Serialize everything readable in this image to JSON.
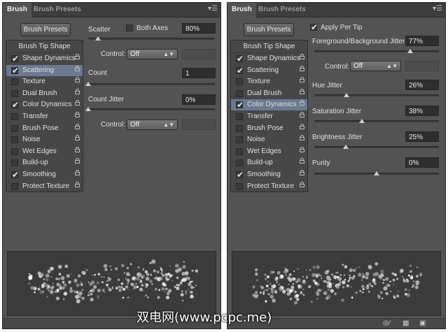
{
  "left": {
    "tabs": [
      "Brush",
      "Brush Presets"
    ],
    "presets_button": "Brush Presets",
    "list_header": "Brush Tip Shape",
    "items": [
      {
        "label": "Shape Dynamics",
        "checked": true,
        "selected": false
      },
      {
        "label": "Scattering",
        "checked": true,
        "selected": true
      },
      {
        "label": "Texture",
        "checked": false,
        "selected": false
      },
      {
        "label": "Dual Brush",
        "checked": false,
        "selected": false
      },
      {
        "label": "Color Dynamics",
        "checked": true,
        "selected": false
      },
      {
        "label": "Transfer",
        "checked": false,
        "selected": false
      },
      {
        "label": "Brush Pose",
        "checked": false,
        "selected": false
      },
      {
        "label": "Noise",
        "checked": false,
        "selected": false
      },
      {
        "label": "Wet Edges",
        "checked": false,
        "selected": false
      },
      {
        "label": "Build-up",
        "checked": false,
        "selected": false
      },
      {
        "label": "Smoothing",
        "checked": true,
        "selected": false
      },
      {
        "label": "Protect Texture",
        "checked": false,
        "selected": false
      }
    ],
    "scatter": {
      "label": "Scatter",
      "both_axes_label": "Both Axes",
      "both_axes_checked": false,
      "value": "80%",
      "level": 0.08
    },
    "control1": {
      "label": "Control:",
      "value": "Off"
    },
    "count": {
      "label": "Count",
      "value": "1",
      "level": 0.0
    },
    "count_jitter": {
      "label": "Count Jitter",
      "value": "0%",
      "level": 0.0
    },
    "control2": {
      "label": "Control:",
      "value": "Off"
    }
  },
  "right": {
    "tabs": [
      "Brush",
      "Brush Presets"
    ],
    "presets_button": "Brush Presets",
    "list_header": "Brush Tip Shape",
    "items": [
      {
        "label": "Shape Dynamics",
        "checked": true,
        "selected": false
      },
      {
        "label": "Scattering",
        "checked": true,
        "selected": false
      },
      {
        "label": "Texture",
        "checked": false,
        "selected": false
      },
      {
        "label": "Dual Brush",
        "checked": false,
        "selected": false
      },
      {
        "label": "Color Dynamics",
        "checked": true,
        "selected": true
      },
      {
        "label": "Transfer",
        "checked": false,
        "selected": false
      },
      {
        "label": "Brush Pose",
        "checked": false,
        "selected": false
      },
      {
        "label": "Noise",
        "checked": false,
        "selected": false
      },
      {
        "label": "Wet Edges",
        "checked": false,
        "selected": false
      },
      {
        "label": "Build-up",
        "checked": false,
        "selected": false
      },
      {
        "label": "Smoothing",
        "checked": true,
        "selected": false
      },
      {
        "label": "Protect Texture",
        "checked": false,
        "selected": false
      }
    ],
    "apply_per_tip": {
      "label": "Apply Per Tip",
      "checked": true
    },
    "fg_bg_jitter": {
      "label": "Foreground/Background Jitter",
      "value": "77%",
      "level": 0.77
    },
    "control": {
      "label": "Control:",
      "value": "Off"
    },
    "hue_jitter": {
      "label": "Hue Jitter",
      "value": "26%",
      "level": 0.26
    },
    "saturation_jitter": {
      "label": "Saturation Jitter",
      "value": "38%",
      "level": 0.38
    },
    "brightness_jitter": {
      "label": "Brightness Jitter",
      "value": "25%",
      "level": 0.25
    },
    "purity": {
      "label": "Purity",
      "value": "0%",
      "level": 0.5
    }
  },
  "icons": [
    "panel-menu-icon",
    "lock-icon",
    "toggle-preview-icon",
    "grid-icon",
    "new-preset-icon"
  ],
  "watermark": "双电网(www.pcpc.me)"
}
